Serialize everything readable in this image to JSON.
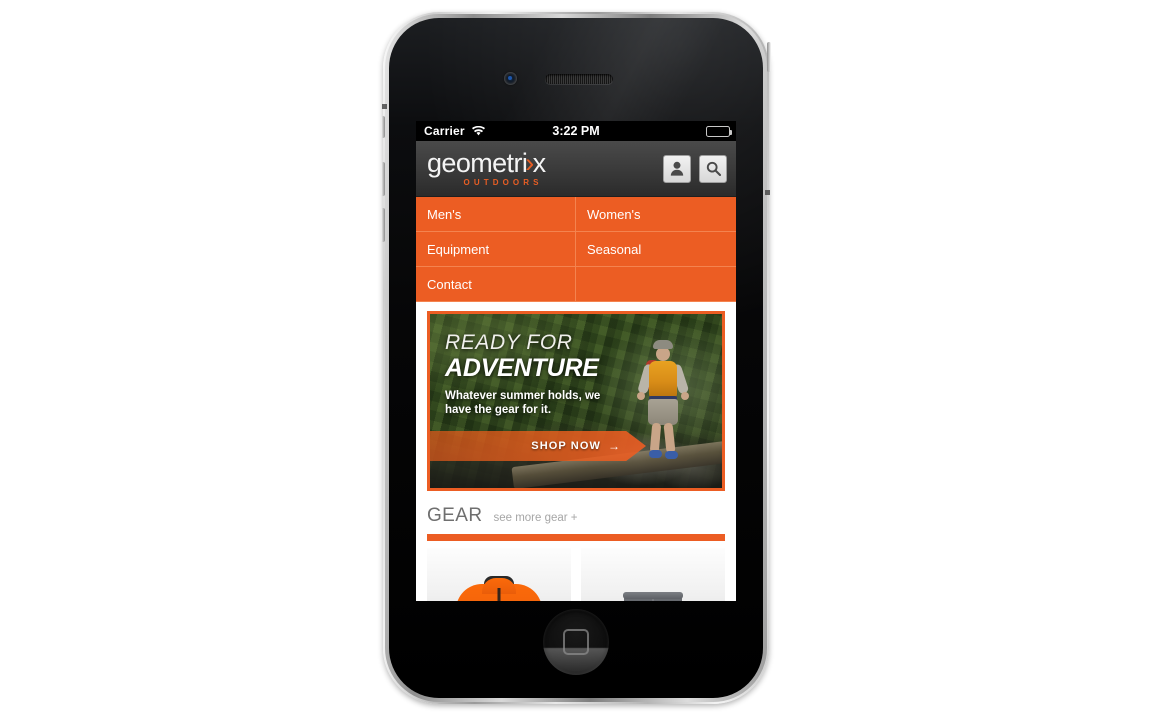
{
  "device": {
    "model_name": "iphone-4-black",
    "camera": "front-camera",
    "speaker": "earpiece-speaker",
    "home_button": "home-button"
  },
  "status_bar": {
    "carrier": "Carrier",
    "wifi_icon": "wifi-icon",
    "time": "3:22 PM",
    "battery_icon": "battery-full-icon"
  },
  "header": {
    "logo": {
      "word_part1": "geometri",
      "chevron": "›",
      "word_part2": "x",
      "tagline": "OUTDOORS"
    },
    "account_button": {
      "icon": "person-icon",
      "label": "Account"
    },
    "search_button": {
      "icon": "search-icon",
      "label": "Search"
    }
  },
  "nav": {
    "items": [
      {
        "label": "Men's"
      },
      {
        "label": "Women's"
      },
      {
        "label": "Equipment"
      },
      {
        "label": "Seasonal"
      },
      {
        "label": "Contact"
      },
      {
        "label": ""
      }
    ]
  },
  "hero": {
    "kicker": "READY FOR",
    "headline": "ADVENTURE",
    "subtitle": "Whatever summer holds, we have the gear for it.",
    "cta_label": "SHOP NOW",
    "cta_arrow": "→",
    "image_alt": "hiker-walking-log-mossy-gorge"
  },
  "gear": {
    "title": "GEAR",
    "see_more": "see more gear +",
    "products": [
      {
        "name": "orange-jacket"
      },
      {
        "name": "gray-shorts"
      }
    ]
  },
  "colors": {
    "brand_orange": "#ec5d23",
    "nav_divider": "#f4834f",
    "header_dark": "#3e3e3e",
    "gear_title_gray": "#6f6f6f",
    "gear_more_gray": "#a6a6a6",
    "page_background": "#ffffff"
  }
}
